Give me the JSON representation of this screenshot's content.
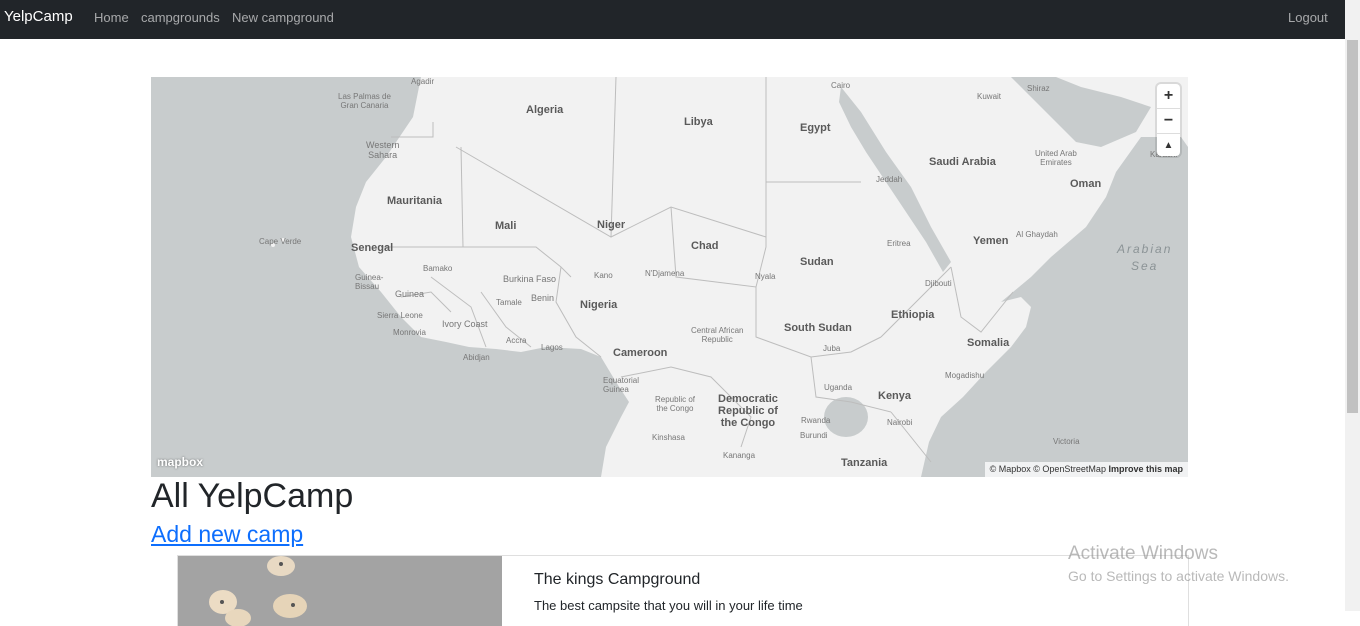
{
  "navbar": {
    "brand": "YelpCamp",
    "links": [
      "Home",
      "campgrounds",
      "New campground"
    ],
    "logout": "Logout"
  },
  "map": {
    "countries": [
      "Algeria",
      "Libya",
      "Egypt",
      "Saudi Arabia",
      "Oman",
      "Yemen",
      "Mauritania",
      "Mali",
      "Niger",
      "Chad",
      "Sudan",
      "South Sudan",
      "Ethiopia",
      "Somalia",
      "Nigeria",
      "Cameroon",
      "Kenya",
      "Tanzania",
      "Senegal",
      "Guinea",
      "Burkina Faso",
      "Benin",
      "Ivory Coast"
    ],
    "labels": {
      "las_palmas": "Las Palmas de\nGran Canaria",
      "agadir": "Agadir",
      "western_sahara": "Western\nSahara",
      "cape_verde": "Cape Verde",
      "cairo": "Cairo",
      "shiraz": "Shiraz",
      "kuwait": "Kuwait",
      "jeddah": "Jeddah",
      "uae": "United Arab\nEmirates",
      "karachi": "Karachi",
      "eritrea": "Eritrea",
      "al_ghaydah": "Al Ghaydah",
      "arabian_sea": "Arabian\nSea",
      "djibouti": "Djibouti",
      "bamako": "Bamako",
      "guinea_bissau": "Guinea-\nBissau",
      "kano": "Kano",
      "ndjamena": "N'Djamena",
      "nyala": "Nyala",
      "sierra_leone": "Sierra Leone",
      "monrovia": "Monrovia",
      "tamale": "Tamale",
      "accra": "Accra",
      "lagos": "Lagos",
      "abidjan": "Abidjan",
      "car": "Central African\nRepublic",
      "juba": "Juba",
      "mogadishu": "Mogadishu",
      "equatorial_guinea": "Equatorial\nGuinea",
      "roc": "Republic of\nthe Congo",
      "drc": "Democratic\nRepublic of\nthe Congo",
      "uganda": "Uganda",
      "rwanda": "Rwanda",
      "burundi": "Burundi",
      "nairobi": "Nairobi",
      "kinshasa": "Kinshasa",
      "kananga": "Kananga",
      "victoria": "Victoria"
    },
    "zoom_in": "+",
    "zoom_out": "−",
    "compass": "▲",
    "logo": "mapbox",
    "attribution": "© Mapbox © OpenStreetMap",
    "improve": "Improve this map"
  },
  "page": {
    "heading": "All YelpCamp",
    "add_link": "Add new camp"
  },
  "card": {
    "title": "The kings Campground",
    "description": "The best campsite that you will in your life time"
  },
  "activation": {
    "title": "Activate Windows",
    "subtitle": "Go to Settings to activate Windows."
  }
}
